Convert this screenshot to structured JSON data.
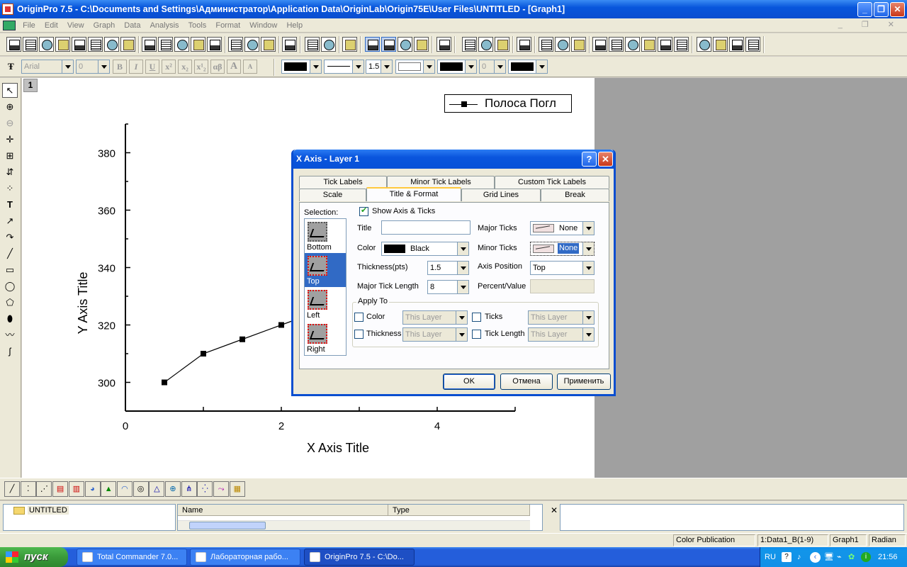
{
  "window": {
    "title": "OriginPro 7.5 - C:\\Documents and Settings\\Администратор\\Application Data\\OriginLab\\Origin75E\\User Files\\UNTITLED - [Graph1]"
  },
  "menu": [
    "File",
    "Edit",
    "View",
    "Graph",
    "Data",
    "Analysis",
    "Tools",
    "Format",
    "Window",
    "Help"
  ],
  "format_toolbar": {
    "font": "Arial",
    "font_size": "0",
    "bold": "B",
    "italic": "I",
    "underline": "U",
    "superscript": "x²",
    "subscript": "x₂",
    "supsub": "x¹₂",
    "greek": "αβ",
    "bigger": "A",
    "smaller": "A",
    "line_width": "1.5",
    "pattern_value": "0"
  },
  "graph": {
    "layer_badge": "1",
    "legend": "Полоса Погл",
    "chart_data": {
      "type": "line",
      "xlabel": "X Axis Title",
      "ylabel": "Y Axis Title",
      "xlim": [
        0,
        5
      ],
      "ylim": [
        290,
        390
      ],
      "xticks": [
        "0",
        "2",
        "4"
      ],
      "yticks": [
        "300",
        "320",
        "340",
        "360",
        "380"
      ],
      "x": [
        0.5,
        1.0,
        1.5,
        2.0,
        2.5
      ],
      "series": [
        {
          "name": "Полоса Погл",
          "values": [
            300,
            310,
            315,
            320,
            325
          ]
        }
      ],
      "grid": false,
      "legend": "top-right",
      "color": "#000000"
    }
  },
  "dialog": {
    "title": "X Axis - Layer 1",
    "help": "?",
    "close": "✕",
    "tabs_back": [
      "Tick Labels",
      "Minor Tick Labels",
      "Custom Tick Labels"
    ],
    "tabs_front": [
      "Scale",
      "Title & Format",
      "Grid Lines",
      "Break"
    ],
    "active_tab": "Title & Format",
    "selection_label": "Selection:",
    "selection_items": [
      "Bottom",
      "Top",
      "Left",
      "Right"
    ],
    "selected_item": "Top",
    "show_axis_label": "Show Axis & Ticks",
    "title_label": "Title",
    "title_value": "",
    "color_label": "Color",
    "color_value": "Black",
    "thickness_label": "Thickness(pts)",
    "thickness_value": "1.5",
    "major_len_label": "Major Tick Length",
    "major_len_value": "8",
    "major_ticks_label": "Major Ticks",
    "major_ticks_value": "None",
    "minor_ticks_label": "Minor Ticks",
    "minor_ticks_value": "None",
    "axis_pos_label": "Axis Position",
    "axis_pos_value": "Top",
    "percent_label": "Percent/Value",
    "apply_to_label": "Apply To",
    "apply_color": "Color",
    "apply_ticks": "Ticks",
    "apply_thickness": "Thickness",
    "apply_tick_length": "Tick Length",
    "this_layer": "This Layer",
    "ok": "OK",
    "cancel": "Отмена",
    "apply": "Применить"
  },
  "explorer": {
    "folder": "UNTITLED",
    "col_name": "Name",
    "col_type": "Type"
  },
  "status": {
    "theme": "Color Publication",
    "data": "1:Data1_B(1-9)",
    "window": "Graph1",
    "units": "Radian"
  },
  "taskbar": {
    "start": "пуск",
    "tasks": [
      "Total Commander 7.0...",
      "Лабораторная рабо...",
      "OriginPro 7.5 - C:\\Do..."
    ],
    "lang": "RU",
    "clock": "21:56"
  }
}
